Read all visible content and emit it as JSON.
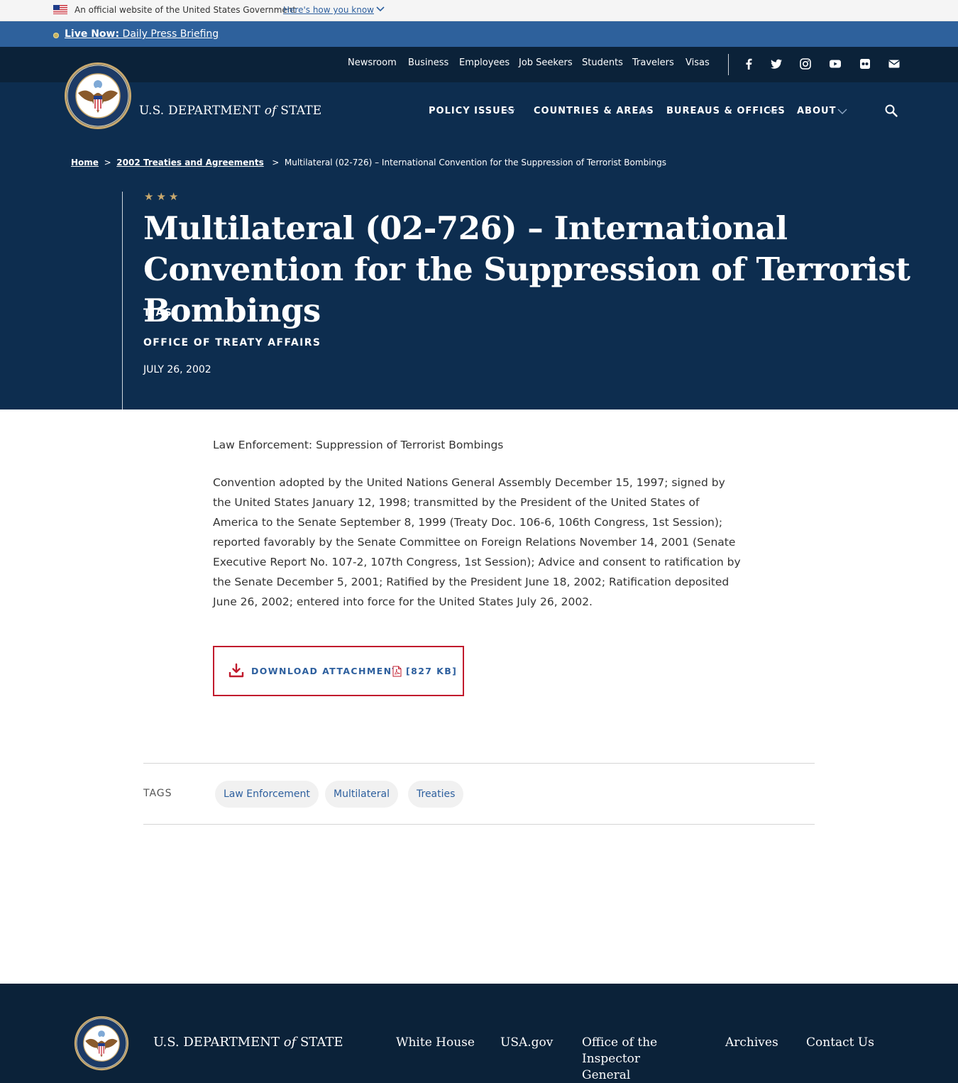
{
  "gov_banner": {
    "text": "An official website of the United States Government",
    "link": "Here's how you know"
  },
  "live_bar": {
    "label": "Live Now:",
    "text": "Daily Press Briefing"
  },
  "utility_nav": [
    "Newsroom",
    "Business",
    "Employees",
    "Job Seekers",
    "Students",
    "Travelers",
    "Visas"
  ],
  "social_icons": [
    "facebook-icon",
    "twitter-icon",
    "instagram-icon",
    "youtube-icon",
    "flickr-icon",
    "email-icon"
  ],
  "brand": {
    "before": "U.S. DEPARTMENT",
    "of": "of",
    "after": "STATE"
  },
  "main_nav": [
    "POLICY ISSUES",
    "COUNTRIES & AREAS",
    "BUREAUS & OFFICES",
    "ABOUT"
  ],
  "breadcrumb": {
    "home": "Home",
    "parent": "2002 Treaties and Agreements",
    "current": "Multilateral (02-726) – International Convention for the Suppression of Terrorist Bombings",
    "sep": ">"
  },
  "stars": "★★★",
  "page": {
    "title": "Multilateral (02-726) – International Convention for the Suppression of Terrorist Bombings",
    "series": "TIAS",
    "office": "OFFICE OF TREATY AFFAIRS",
    "date": "JULY 26, 2002"
  },
  "content": {
    "subject": "Law Enforcement: Suppression of Terrorist Bombings",
    "body": "Convention adopted by the United Nations General Assembly December 15, 1997; signed by the United States January 12, 1998; transmitted by the President of the United States of America to the Senate September 8, 1999 (Treaty Doc. 106-6, 106th Congress, 1st Session); reported favorably by the Senate Committee on Foreign Relations November 14, 2001 (Senate Executive Report No. 107-2, 107th Congress, 1st Session); Advice and consent to ratification by the Senate December 5, 2001; Ratified by the President June 18, 2002; Ratification deposited June 26, 2002; entered into force for the United States July 26, 2002."
  },
  "download": {
    "label": "DOWNLOAD ATTACHMENT",
    "size": "[827 KB]"
  },
  "tags": {
    "label": "TAGS",
    "items": [
      "Law Enforcement",
      "Multilateral",
      "Treaties"
    ]
  },
  "footer": {
    "links": [
      "White House",
      "USA.gov",
      "Office of the Inspector General",
      "Archives",
      "Contact Us"
    ]
  },
  "colors": {
    "navy": "#0d2d4f",
    "dark_navy": "#0b2239",
    "blue": "#2e619c",
    "link_blue": "#2d5f9e",
    "red": "#c11b2d",
    "gold": "#c9a96e"
  }
}
